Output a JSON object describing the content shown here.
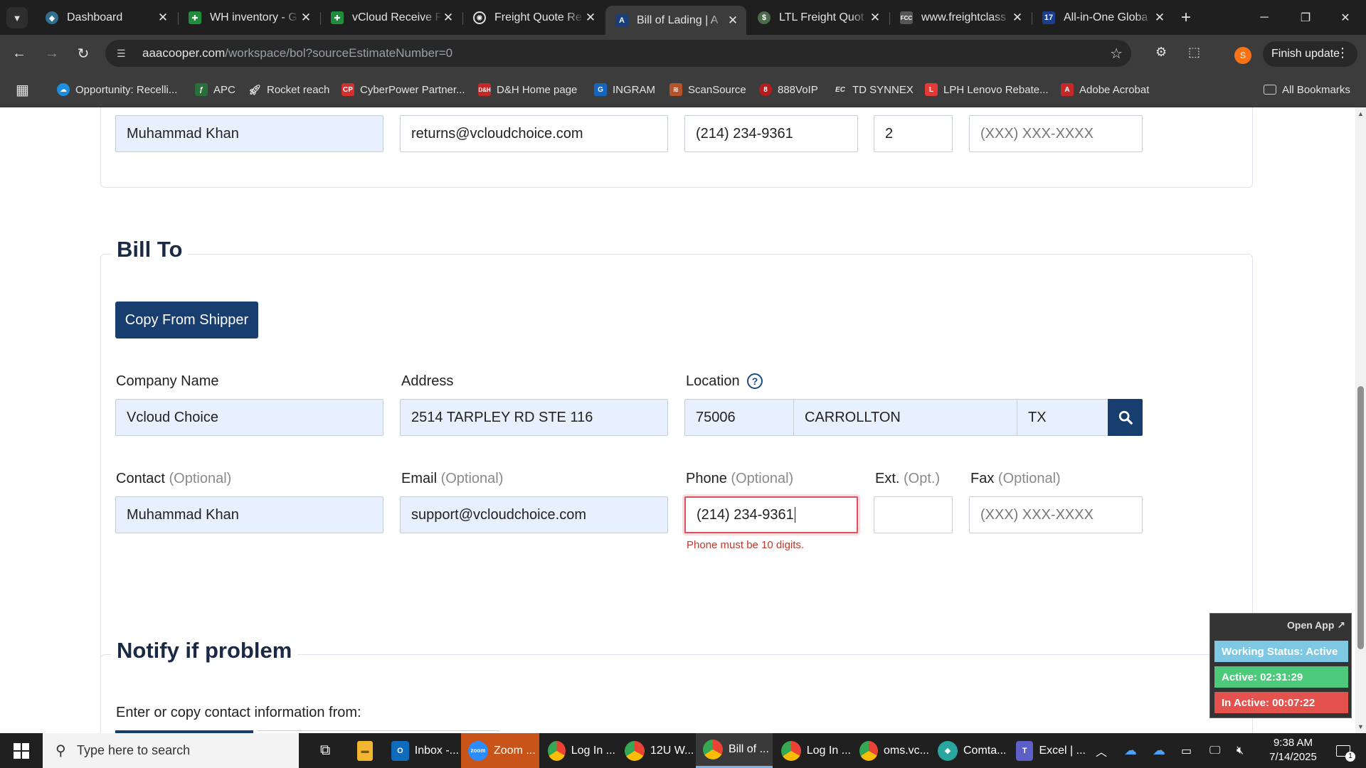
{
  "browser": {
    "tabs": [
      {
        "title": "Dashboard",
        "active": false
      },
      {
        "title": "WH inventory - G",
        "active": false
      },
      {
        "title": "vCloud Receive F",
        "active": false
      },
      {
        "title": "Freight Quote Re",
        "active": false
      },
      {
        "title": "Bill of Lading | A",
        "active": true
      },
      {
        "title": "LTL Freight Quot",
        "active": false
      },
      {
        "title": "www.freightclass",
        "active": false
      },
      {
        "title": "All-in-One Globa",
        "active": false
      }
    ],
    "url_host": "aaacooper.com",
    "url_path": "/workspace/bol?sourceEstimateNumber=0",
    "avatar_letter": "S",
    "finish_update": "Finish update",
    "bookmarks": [
      "Opportunity: Recelli...",
      "APC",
      "Rocket reach",
      "CyberPower Partner...",
      "D&H Home page",
      "INGRAM",
      "ScanSource",
      "888VoIP",
      "TD SYNNEX",
      "LPH Lenovo Rebate...",
      "Adobe Acrobat"
    ],
    "all_bookmarks": "All Bookmarks"
  },
  "shipper_contact": {
    "contact": "Muhammad Khan",
    "email": "returns@vcloudchoice.com",
    "phone": "(214) 234-9361",
    "ext": "2",
    "fax_placeholder": "(XXX) XXX-XXXX"
  },
  "bill_to": {
    "title": "Bill To",
    "copy_button": "Copy From Shipper",
    "labels": {
      "company": "Company Name",
      "address": "Address",
      "location": "Location",
      "contact": "Contact",
      "email": "Email",
      "phone": "Phone",
      "ext": "Ext.",
      "fax": "Fax",
      "optional": "(Optional)",
      "opt": "(Opt.)"
    },
    "company": "Vcloud Choice",
    "address": "2514 TARPLEY RD STE 116",
    "zip": "75006",
    "city": "CARROLLTON",
    "state": "TX",
    "contact": "Muhammad Khan",
    "email": "support@vcloudchoice.com",
    "phone": "(214) 234-9361",
    "ext": "",
    "fax_placeholder": "(XXX) XXX-XXXX",
    "phone_error": "Phone must be 10 digits."
  },
  "notify": {
    "title": "Notify if problem",
    "instructions": "Enter or copy contact information from:"
  },
  "widget": {
    "open_app": "Open App ↗",
    "status": "Working Status: Active",
    "active": "Active: 02:31:29",
    "inactive": "In Active: 00:07:22"
  },
  "taskbar": {
    "search_placeholder": "Type here to search",
    "items": [
      "Inbox -...",
      "Zoom ...",
      "Log In ...",
      "12U W...",
      "Bill of ...",
      "Log In ...",
      "oms.vc...",
      "Comta...",
      "Excel | ..."
    ],
    "time": "9:38 AM",
    "date": "7/14/2025",
    "notification_count": "1"
  }
}
